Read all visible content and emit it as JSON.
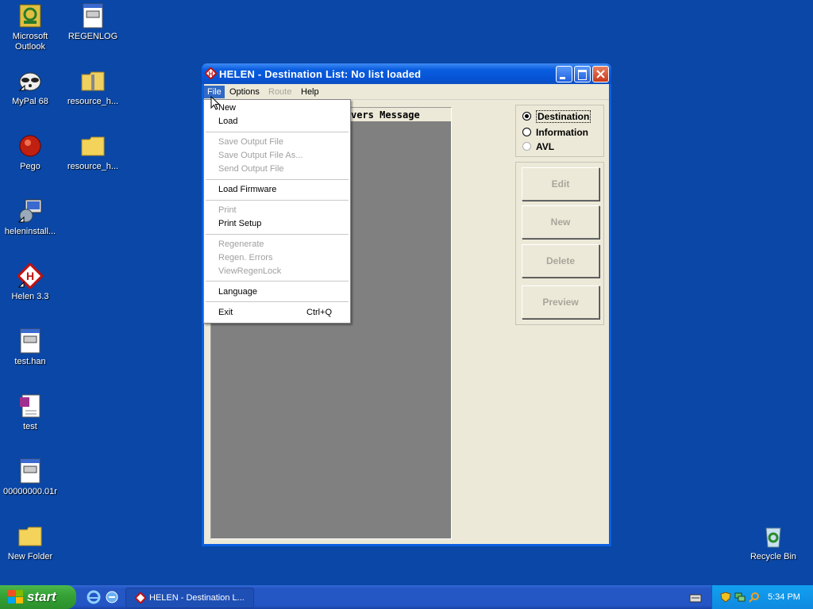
{
  "desktop": {
    "icons": [
      {
        "label": "Microsoft Outlook"
      },
      {
        "label": "REGENLOG"
      },
      {
        "label": "MyPal 68"
      },
      {
        "label": "resource_h..."
      },
      {
        "label": "Pego"
      },
      {
        "label": "resource_h..."
      },
      {
        "label": "heleninstall..."
      },
      {
        "label": "Helen 3.3"
      },
      {
        "label": "test.han"
      },
      {
        "label": "test"
      },
      {
        "label": "00000000.01r"
      },
      {
        "label": "New Folder"
      },
      {
        "label": "Recycle Bin"
      }
    ]
  },
  "window": {
    "title": "HELEN - Destination List: No list loaded",
    "menus": [
      "File",
      "Options",
      "Route",
      "Help"
    ],
    "list_header": "vers Message",
    "radios": [
      {
        "label": "Destination",
        "checked": true
      },
      {
        "label": "Information",
        "checked": false
      },
      {
        "label": "AVL",
        "checked": false
      }
    ],
    "buttons": [
      "Edit",
      "New",
      "Delete",
      "Preview"
    ]
  },
  "file_menu": {
    "items": [
      {
        "label": "New",
        "enabled": true
      },
      {
        "label": "Load",
        "enabled": true
      },
      {
        "label": "Save Output File",
        "enabled": false
      },
      {
        "label": "Save Output File As...",
        "enabled": false
      },
      {
        "label": "Send Output File",
        "enabled": false
      },
      {
        "label": "Load Firmware",
        "enabled": true
      },
      {
        "label": "Print",
        "enabled": false
      },
      {
        "label": "Print Setup",
        "enabled": true
      },
      {
        "label": "Regenerate",
        "enabled": false
      },
      {
        "label": "Regen. Errors",
        "enabled": false
      },
      {
        "label": "ViewRegenLock",
        "enabled": false
      },
      {
        "label": "Language",
        "enabled": true
      },
      {
        "label": "Exit",
        "enabled": true,
        "shortcut": "Ctrl+Q"
      }
    ]
  },
  "taskbar": {
    "start_label": "start",
    "task_label": "HELEN - Destination L...",
    "clock": "5:34 PM"
  },
  "colors": {
    "desktop": "#0a47a6",
    "titlebar": "#0654d6",
    "start": "#36a336"
  }
}
